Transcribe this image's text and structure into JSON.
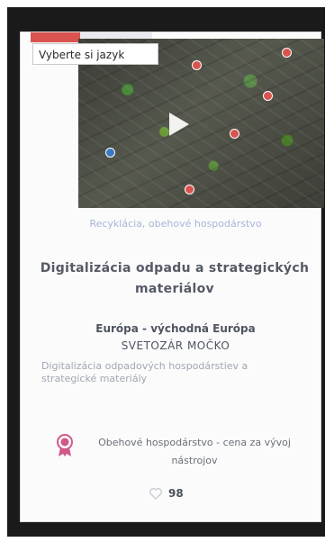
{
  "card": {
    "language_chip": "Vyberte si jazyk",
    "category": "Recyklácia, obehové hospodárstvo",
    "title": "Digitalizácia odpadu a strategických materiálov",
    "region": "Európa - východná Európa",
    "author": "SVETOZÁR MOČKO",
    "description": "Digitalizácia odpadových hospodárstiev a strategické materiály",
    "award": "Obehové hospodárstvo - cena za vývoj nástrojov",
    "likes": "98"
  },
  "colors": {
    "accent": "#d9534f",
    "award": "#d0598a",
    "category_text": "#a7b5d8"
  },
  "icons": {
    "play": "play-icon",
    "medal": "medal-icon",
    "heart": "heart-icon"
  }
}
